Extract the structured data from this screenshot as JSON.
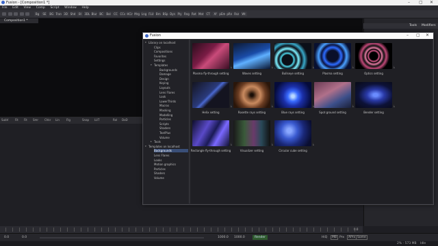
{
  "app": {
    "title": "Fusion - [Composition1 *]",
    "window_controls": [
      "–",
      "▢",
      "✕"
    ]
  },
  "menu": [
    "File",
    "Edit",
    "View",
    "Comp",
    "Script",
    "Window",
    "Help"
  ],
  "toolbar": {
    "buttons": [
      "Bg",
      "SE",
      "BG",
      "Tran",
      "3D",
      "Shd",
      "Bl",
      "3DL",
      "Blur",
      "BC",
      "Bol",
      "CC",
      "CCv",
      "HCir",
      "Mrg",
      "Lng",
      "FLU",
      "Brn",
      "BSp",
      "Dyn",
      "Ply",
      "Rng",
      "Rot",
      "Mat",
      "CT",
      "Xf",
      "pEm",
      "pRn",
      "Rsz",
      "Wt"
    ]
  },
  "composition_tab": "Composition1 *",
  "viewer_toolbar": {
    "items": [
      "SubV",
      "Fit",
      "Fit",
      "Smr",
      "Chkr",
      "Lin",
      "Flg",
      "Snap",
      "LUT",
      "Rol",
      "DoD"
    ]
  },
  "right_panel": {
    "tabs": [
      "Tools",
      "Modifiers"
    ]
  },
  "dialog": {
    "title": "Fusion",
    "window_controls": [
      "–",
      "▢",
      "✕"
    ],
    "tree": [
      {
        "label": "Library on localhost",
        "depth": 0,
        "expanded": true
      },
      {
        "label": "Clips",
        "depth": 1
      },
      {
        "label": "Compositions",
        "depth": 1
      },
      {
        "label": "Favorites",
        "depth": 1
      },
      {
        "label": "Settings",
        "depth": 1
      },
      {
        "label": "Templates",
        "depth": 1,
        "expanded": true
      },
      {
        "label": "Backgrounds",
        "depth": 2
      },
      {
        "label": "Damage",
        "depth": 2
      },
      {
        "label": "Design",
        "depth": 2
      },
      {
        "label": "Keying",
        "depth": 2
      },
      {
        "label": "Layouts",
        "depth": 2
      },
      {
        "label": "Lens Flares",
        "depth": 2
      },
      {
        "label": "Look",
        "depth": 2
      },
      {
        "label": "LowerThirds",
        "depth": 2
      },
      {
        "label": "Macros",
        "depth": 2
      },
      {
        "label": "Masking",
        "depth": 2
      },
      {
        "label": "Modelling",
        "depth": 2
      },
      {
        "label": "Particles",
        "depth": 2
      },
      {
        "label": "Scripts",
        "depth": 2
      },
      {
        "label": "Shaders",
        "depth": 2
      },
      {
        "label": "TextPlus",
        "depth": 2
      },
      {
        "label": "Volume",
        "depth": 2
      },
      {
        "label": "Tools",
        "depth": 1,
        "expanded": false
      },
      {
        "label": "Templates on localhost",
        "depth": 0,
        "expanded": true
      },
      {
        "label": "Backgrounds",
        "depth": 1,
        "selected": true
      },
      {
        "label": "Lens Flares",
        "depth": 1
      },
      {
        "label": "Looks",
        "depth": 1
      },
      {
        "label": "Motion graphics",
        "depth": 1
      },
      {
        "label": "Particles",
        "depth": 1
      },
      {
        "label": "Shaders",
        "depth": 1
      },
      {
        "label": "Volume",
        "depth": 1
      }
    ],
    "gallery": [
      {
        "label": "Plasma fly-through setting",
        "bg": "linear-gradient(135deg,#2a0d1c,#7a1c45 40%,#c94b7a 55%,#3a0e24)"
      },
      {
        "label": "Waves setting",
        "bg": "linear-gradient(160deg,#0d1a33,#1a4ca8 45%,#5fb0ff 60%,#0a1530)"
      },
      {
        "label": "Bullseye setting",
        "bg": "radial-gradient(circle at 35% 65%,#0b0f18 18%,#4cd2e6 22%,#0b0f18 30%,#7ef0ff 38%,#0b0f18 48%,#39a8c8 58%,#0b0f18 70%)"
      },
      {
        "label": "Plasma setting",
        "bg": "radial-gradient(circle at 50% 50%,#0a0f2a 25%,#2d6cff 38%,#0c1440 50%,#4aa0ff 62%,#081030 80%)"
      },
      {
        "label": "Optics setting",
        "bg": "radial-gradient(circle at 50% 50%,#000 18%,#d95a8c 24%,#000 30%,#e87da6 36%,#111 46%,#c04878 56%,#000 70%)"
      },
      {
        "label": "Helix setting",
        "bg": "linear-gradient(135deg,#141420,#2a3a7a 45%,#4a68d0 50%,#141420 60%)"
      },
      {
        "label": "Rosette rays setting",
        "bg": "radial-gradient(circle at 50% 50%,#1a0e06 6%,#8a5a3a 22%,#c98a5f 38%,#6a3c22 60%,#2a160a 85%)"
      },
      {
        "label": "Blue rays setting",
        "bg": "radial-gradient(circle at 50% 55%,#b8d8ff 6%,#3a6cff 22%,#1b2fa8 42%,#050b3a 80%)"
      },
      {
        "label": "Spot ground setting",
        "bg": "linear-gradient(150deg,#6a3c55,#b0708a 40%,#3c4f8a 70%,#1a2038)"
      },
      {
        "label": "Bender setting",
        "bg": "radial-gradient(ellipse at 55% 50%,#6a8cff 8%,#2a3aa8 30%,#0d1238 60%,#0a0c1c 90%)"
      },
      {
        "label": "Rectangle fly-through setting",
        "bg": "linear-gradient(120deg,#0e0e2a,#5a4ac8 35%,#1a1a55 55%,#7a68ff 70%,#101030)"
      },
      {
        "label": "Visualizer setting",
        "bg": "linear-gradient(90deg,#1a1a1a,#3a5a3a 30%,#6a3a6a 55%,#2a4a5a 75%,#111)"
      },
      {
        "label": "Circular cube setting",
        "bg": "radial-gradient(circle at 40% 40%,#8aa8ff 8%,#3a5ad0 30%,#1a2878 55%,#0a0e30 85%)"
      }
    ]
  },
  "transport": {
    "start": "0.0",
    "current": "0.0",
    "end": "1000.0",
    "end2": "1000.0",
    "render_label": "Render",
    "hiq": "HiQ",
    "mb": "MB",
    "prx": "Prx",
    "aprx": "APrx",
    "some": "Some",
    "right_field": "0.0"
  },
  "status": {
    "zoom": "2% - 573 MB",
    "state": "Idle"
  }
}
